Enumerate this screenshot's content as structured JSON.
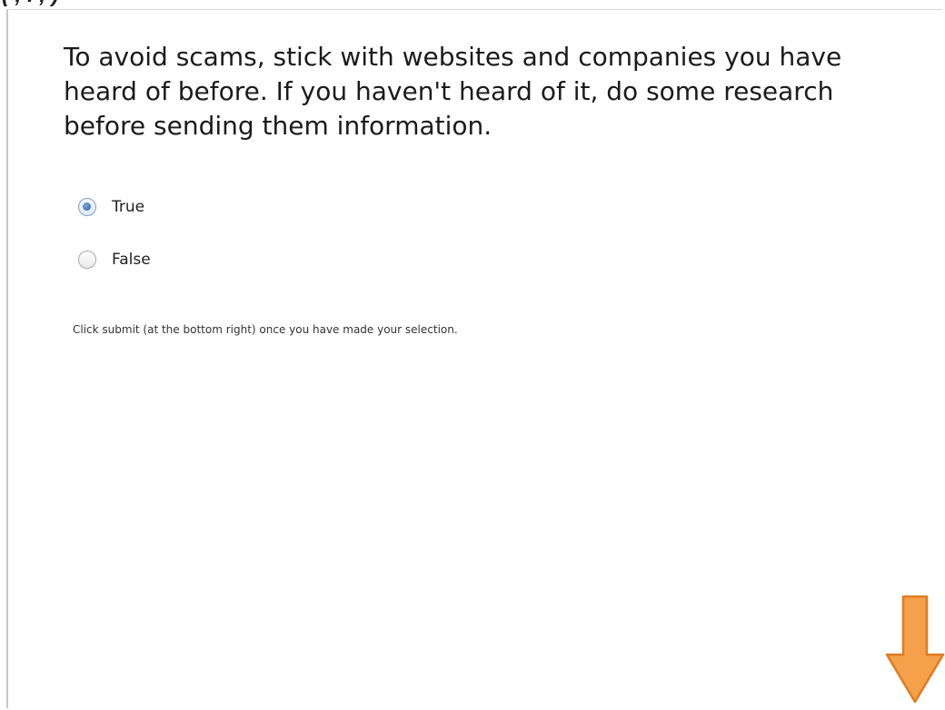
{
  "header": {
    "caption": "(                    ,         .                ,                                                  )"
  },
  "question": {
    "text": "To avoid scams, stick with websites and companies you have heard of before. If you haven't heard of it, do some research before sending them information."
  },
  "options": [
    {
      "label": "True",
      "selected": true
    },
    {
      "label": "False",
      "selected": false
    }
  ],
  "instruction": "Click submit (at the bottom right) once you have made your selection.",
  "arrow": {
    "icon": "down-arrow-icon",
    "color": "#f5a04a",
    "stroke": "#e07b22"
  }
}
